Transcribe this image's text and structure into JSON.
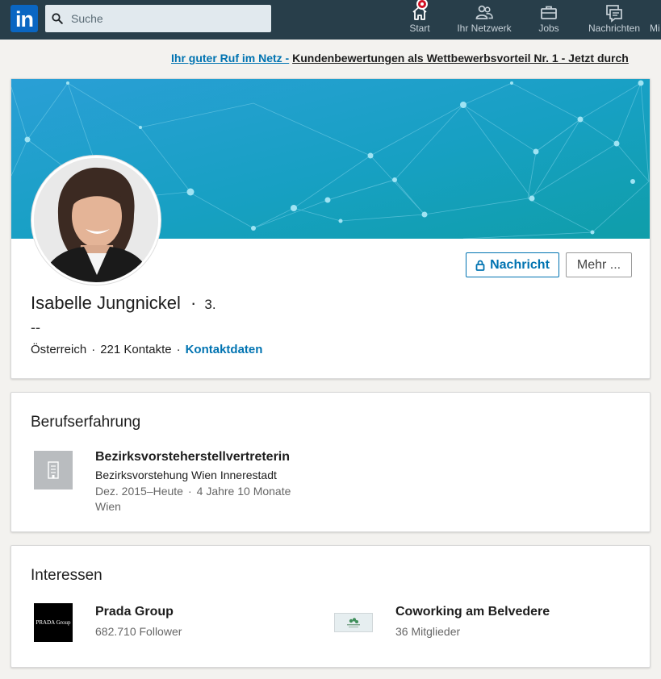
{
  "nav": {
    "logo": "in",
    "search_placeholder": "Suche",
    "items": [
      {
        "label": "Start"
      },
      {
        "label": "Ihr Netzwerk"
      },
      {
        "label": "Jobs"
      },
      {
        "label": "Nachrichten"
      },
      {
        "label": "Mi"
      }
    ]
  },
  "ad": {
    "link": "Ihr guter Ruf im Netz -",
    "text": "Kundenbewertungen als Wettbewerbsvorteil Nr. 1 - Jetzt durch"
  },
  "profile": {
    "name": "Isabelle Jungnickel",
    "degree": "3.",
    "headline": "--",
    "location": "Österreich",
    "connections": "221 Kontakte",
    "contact_link": "Kontaktdaten",
    "message_button": "Nachricht",
    "more_button": "Mehr ..."
  },
  "experience": {
    "title": "Berufserfahrung",
    "items": [
      {
        "role": "Bezirksvorsteherstellvertreterin",
        "org": "Bezirksvorstehung Wien Innerestadt",
        "dates": "Dez. 2015–Heute",
        "duration": "4 Jahre 10 Monate",
        "location": "Wien"
      }
    ]
  },
  "interests": {
    "title": "Interessen",
    "items": [
      {
        "name": "Prada Group",
        "subtitle": "682.710 Follower",
        "logo_text": "PRADA Group"
      },
      {
        "name": "Coworking am Belvedere",
        "subtitle": "36 Mitglieder"
      }
    ]
  },
  "colors": {
    "nav_bg": "#283e4a",
    "brand_blue": "#0073b1",
    "banner_start": "#1d9bd1",
    "banner_end": "#13a0a5"
  }
}
